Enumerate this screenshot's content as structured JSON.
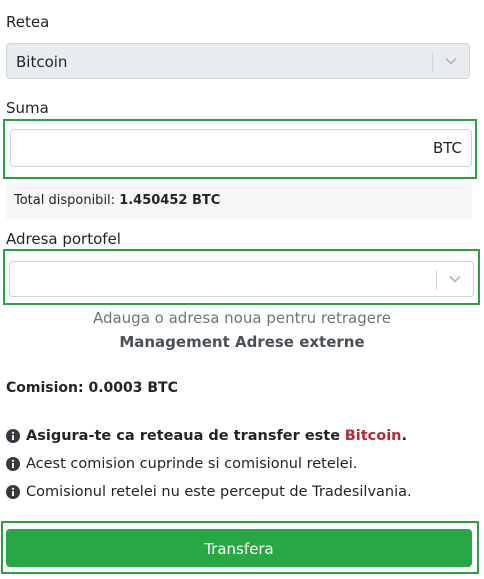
{
  "network": {
    "label": "Retea",
    "selected": "Bitcoin"
  },
  "amount": {
    "label": "Suma",
    "value": "",
    "suffix": "BTC"
  },
  "balance": {
    "label": "Total disponibil:",
    "value": "1.450452 BTC"
  },
  "wallet": {
    "label": "Adresa portofel",
    "selected": ""
  },
  "links": {
    "add_address": "Adauga o adresa noua pentru retragere",
    "manage_addresses": "Management Adrese externe"
  },
  "fee": {
    "text": "Comision: 0.0003 BTC"
  },
  "notes": {
    "network_check_prefix": "Asigura-te ca reteaua de transfer este",
    "network_name": "Bitcoin",
    "network_check_suffix": ".",
    "fee_includes": "Acest comision cuprinde si comisionul retelei.",
    "fee_not_charged": "Comisionul retelei nu este perceput de Tradesilvania."
  },
  "submit": {
    "label": "Transfera"
  },
  "colors": {
    "primary_button": "#28a745",
    "highlight": "#2ea043",
    "network_name": "#b52a35"
  }
}
